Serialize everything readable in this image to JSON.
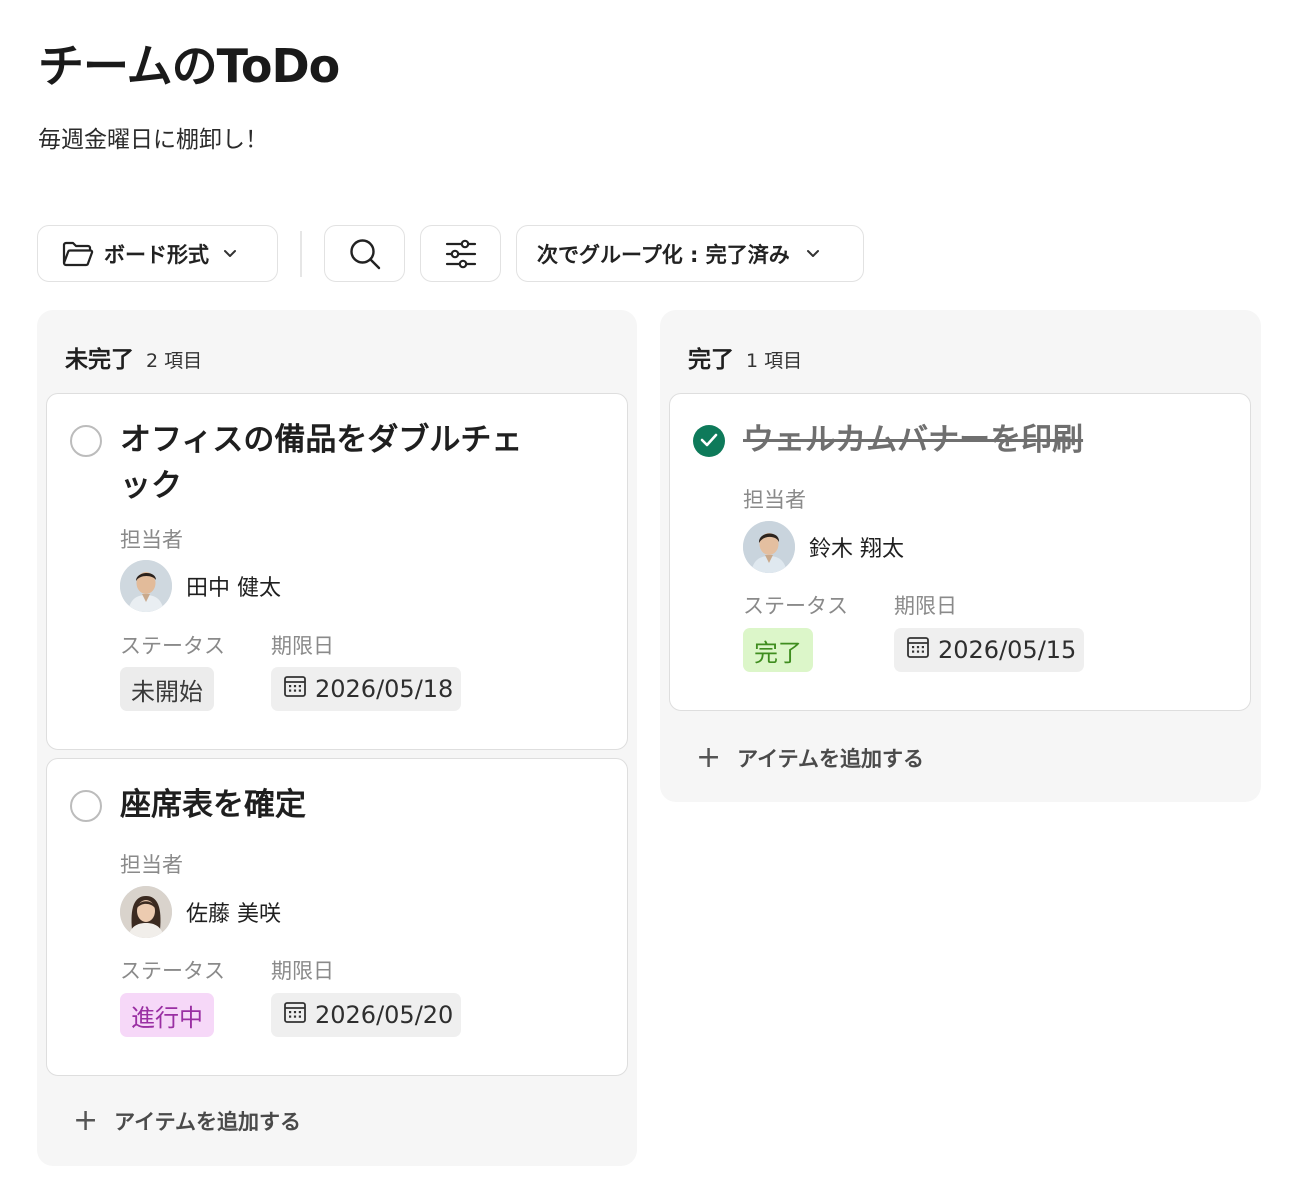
{
  "page": {
    "title": "チームのToDo",
    "subtitle": "毎週金曜日に棚卸し！"
  },
  "toolbar": {
    "view_label": "ボード形式",
    "view_icon": "folder-icon",
    "search_icon": "search-icon",
    "filter_icon": "sliders-icon",
    "group_label": "次でグループ化 : 完了済み"
  },
  "labels": {
    "assignee": "担当者",
    "status": "ステータス",
    "due": "期限日",
    "add_item": "アイテムを追加する"
  },
  "columns": [
    {
      "name": "未完了",
      "count": "2 項目",
      "cards": [
        {
          "title": "オフィスの備品をダブルチェック",
          "done": false,
          "assignee": "田中 健太",
          "status": "未開始",
          "status_color": "#ececec",
          "due": "2026/05/18"
        },
        {
          "title": "座席表を確定",
          "done": false,
          "assignee": "佐藤 美咲",
          "status": "進行中",
          "status_color": "#f6d8f8",
          "due": "2026/05/20"
        }
      ]
    },
    {
      "name": "完了",
      "count": "1 項目",
      "cards": [
        {
          "title": "ウェルカムバナーを印刷",
          "done": true,
          "assignee": "鈴木 翔太",
          "status": "完了",
          "status_color": "#dcf6c9",
          "due": "2026/05/15"
        }
      ]
    }
  ],
  "colors": {
    "check_done": "#0e7a5a",
    "column_bg": "#f6f6f6"
  }
}
